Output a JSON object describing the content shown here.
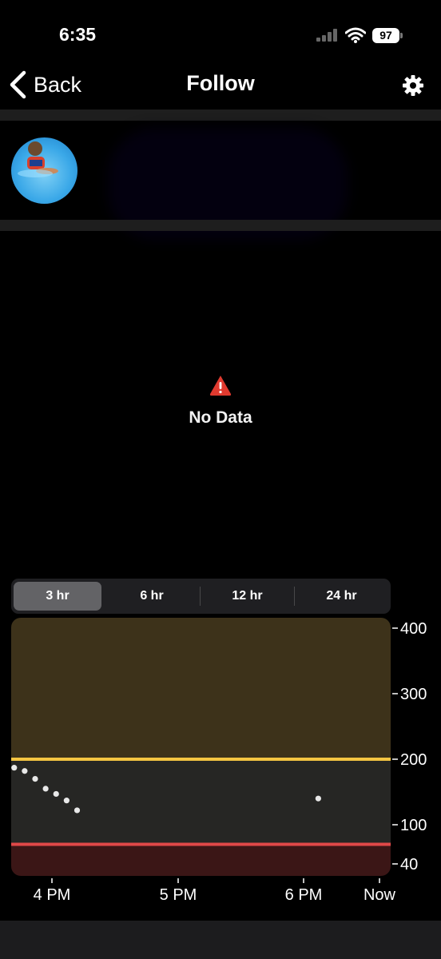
{
  "status_bar": {
    "time": "6:35",
    "battery": "97"
  },
  "nav": {
    "back_label": "Back",
    "title": "Follow"
  },
  "message": {
    "text": "No Data"
  },
  "time_ranges": {
    "items": [
      "3 hr",
      "6 hr",
      "12 hr",
      "24 hr"
    ],
    "selected": "3 hr"
  },
  "chart_data": {
    "type": "scatter",
    "x_ticks": [
      "4 PM",
      "5 PM",
      "6 PM",
      "Now"
    ],
    "y_ticks": [
      400,
      300,
      200,
      100,
      40
    ],
    "ylim": [
      40,
      400
    ],
    "high_line": 200,
    "low_line": 70,
    "colors": {
      "high_zone": "#3d321a",
      "in_range": "#262624",
      "low_zone": "#3b1616",
      "high_line": "#f5c542",
      "low_line": "#e04848",
      "points": "#e8e8e8"
    },
    "points": [
      {
        "t": "3:42 PM",
        "y": 187
      },
      {
        "t": "3:47 PM",
        "y": 182
      },
      {
        "t": "3:52 PM",
        "y": 170
      },
      {
        "t": "3:57 PM",
        "y": 155
      },
      {
        "t": "4:02 PM",
        "y": 147
      },
      {
        "t": "4:07 PM",
        "y": 137
      },
      {
        "t": "4:12 PM",
        "y": 122
      },
      {
        "t": "6:07 PM",
        "y": 140
      }
    ]
  }
}
